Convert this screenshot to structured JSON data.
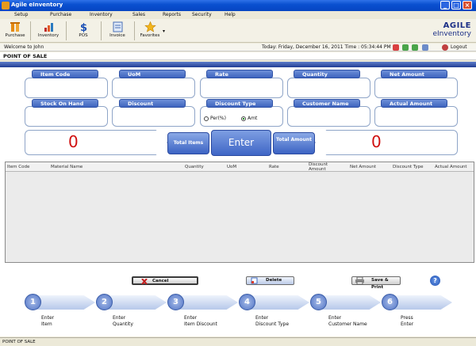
{
  "window": {
    "title": "Agile eInventory",
    "min": "_",
    "max": "□",
    "close": "×"
  },
  "menu": [
    "Setup",
    "Purchase",
    "Inventory",
    "Sales",
    "Reports",
    "Security",
    "Help"
  ],
  "toolbar": {
    "purchase": "Purchase",
    "inventory": "Inventory",
    "pos": "POS",
    "invoice": "Invoice",
    "favorites": "Favorites",
    "favorites_arrow": "▾"
  },
  "brand": {
    "line1": "AGILE",
    "line2": "eInventory"
  },
  "info": {
    "welcome": "Welcome to John",
    "datetime": "Today: Friday, December 16, 2011  Time : 05:34:44 PM",
    "logout": "Logout"
  },
  "page_title": "POINT OF SALE",
  "fields": {
    "item_code": "Item Code",
    "uom": "UoM",
    "rate": "Rate",
    "quantity": "Quantity",
    "net_amount": "Net Amount",
    "stock_on_hand": "Stock On Hand",
    "discount": "Discount",
    "discount_type": "Discount Type",
    "customer_name": "Customer Name",
    "actual_amount": "Actual Amount"
  },
  "discount_type": {
    "per": "Per(%)",
    "amt": "Amt",
    "selected": "Amt"
  },
  "totals": {
    "total_items_label": "Total Items",
    "enter_label": "Enter",
    "total_amount_label": "Total Amount",
    "total_items_value": "0",
    "total_amount_value": "0"
  },
  "table": {
    "columns": [
      "Item Code",
      "Material Name",
      "Quantity",
      "UoM",
      "Rate",
      "Discount Amount",
      "Net Amount",
      "Discount Type",
      "Actual Amount"
    ]
  },
  "actions": {
    "cancel": "Cancel",
    "delete": "Delete",
    "save_print": "Save & Print",
    "help": "?"
  },
  "steps": [
    {
      "num": "1",
      "text": "Enter\nItem"
    },
    {
      "num": "2",
      "text": "Enter\nQuantity"
    },
    {
      "num": "3",
      "text": "Enter\nItem Discount"
    },
    {
      "num": "4",
      "text": "Enter\nDiscount Type"
    },
    {
      "num": "5",
      "text": "Enter\nCustomer Name"
    },
    {
      "num": "6",
      "text": "Press\nEnter"
    }
  ],
  "status": "POINT OF SALE",
  "colors": {
    "accent": "#3e64be",
    "counter": "#d01010",
    "titlebar": "#0a50d0"
  }
}
